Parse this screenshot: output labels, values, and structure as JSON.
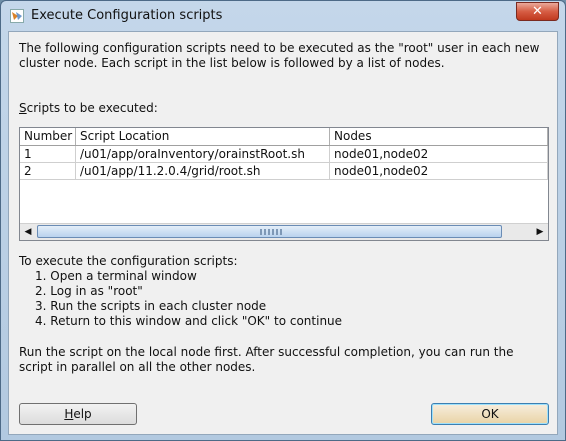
{
  "window": {
    "title": "Execute Configuration scripts",
    "close_glyph": "✕"
  },
  "intro_text": "The following configuration scripts need to be executed as the \"root\" user in each new cluster node. Each script in the list below is followed by a list of nodes.",
  "scripts_label": {
    "mnemonic": "S",
    "rest": "cripts to be executed:"
  },
  "table": {
    "columns": [
      "Number",
      "Script Location",
      "Nodes"
    ],
    "rows": [
      {
        "number": "1",
        "location": "/u01/app/oraInventory/orainstRoot.sh",
        "nodes": "node01,node02"
      },
      {
        "number": "2",
        "location": "/u01/app/11.2.0.4/grid/root.sh",
        "nodes": "node01,node02"
      }
    ]
  },
  "instructions": {
    "heading": "To execute the configuration scripts:",
    "steps": [
      "1. Open a terminal window",
      "2. Log in as \"root\"",
      "3. Run the scripts in each cluster node",
      "4. Return to this window and click \"OK\" to continue"
    ]
  },
  "note_text": "Run the script on the local node first. After successful completion, you can run the script in parallel on all the other nodes.",
  "buttons": {
    "help_mnemonic": "H",
    "help_rest": "elp",
    "ok": "OK"
  }
}
